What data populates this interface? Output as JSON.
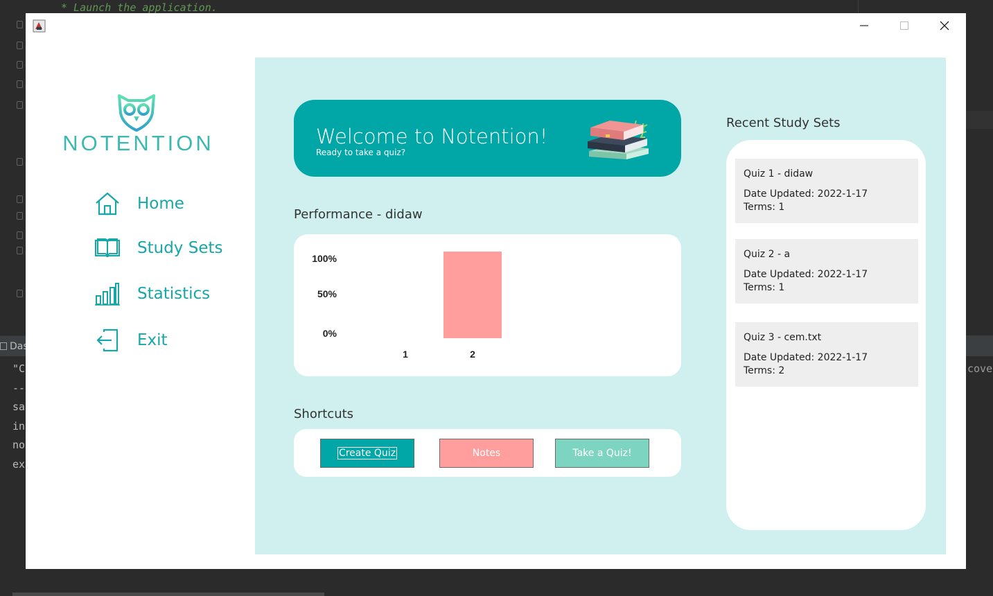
{
  "ide": {
    "code_line": "* Launch the application.",
    "panel_title": "Das",
    "console_lines": [
      "\"C",
      "--",
      "sa",
      "in",
      "no",
      "ex"
    ],
    "console_right": "cover"
  },
  "window": {
    "controls": {
      "minimize": "minimize",
      "maximize": "maximize",
      "close": "close"
    }
  },
  "sidebar": {
    "logo_text": "NOTENTION",
    "nav": [
      {
        "label": "Home",
        "icon": "home-icon"
      },
      {
        "label": "Study Sets",
        "icon": "book-icon"
      },
      {
        "label": "Statistics",
        "icon": "bar-chart-icon"
      },
      {
        "label": "Exit",
        "icon": "exit-icon"
      }
    ]
  },
  "welcome": {
    "title": "Welcome to Notention!",
    "subtitle": "Ready to take a quiz?"
  },
  "performance": {
    "title": "Performance - didaw"
  },
  "chart_data": {
    "type": "bar",
    "categories": [
      "1",
      "2"
    ],
    "values": [
      0,
      100
    ],
    "y_ticks": [
      "0%",
      "50%",
      "100%"
    ],
    "ylim": [
      0,
      100
    ],
    "bar_color": "#ff9e9d",
    "grid": false
  },
  "shortcuts": {
    "title": "Shortcuts",
    "buttons": [
      "Create Quiz",
      "Notes",
      "Take a Quiz!"
    ]
  },
  "recent": {
    "title": "Recent Study Sets",
    "items": [
      {
        "name": "Quiz 1 - didaw",
        "date": "Date Updated: 2022-1-17",
        "terms": "Terms: 1"
      },
      {
        "name": "Quiz 2 - a",
        "date": "Date Updated: 2022-1-17",
        "terms": "Terms: 1"
      },
      {
        "name": "Quiz 3 - cem.txt",
        "date": "Date Updated: 2022-1-17",
        "terms": "Terms: 2"
      }
    ]
  },
  "colors": {
    "teal": "#00a7a6",
    "panel_bg": "#cff0ef",
    "pink": "#ff9e9d",
    "mint": "#7dd4c1"
  }
}
